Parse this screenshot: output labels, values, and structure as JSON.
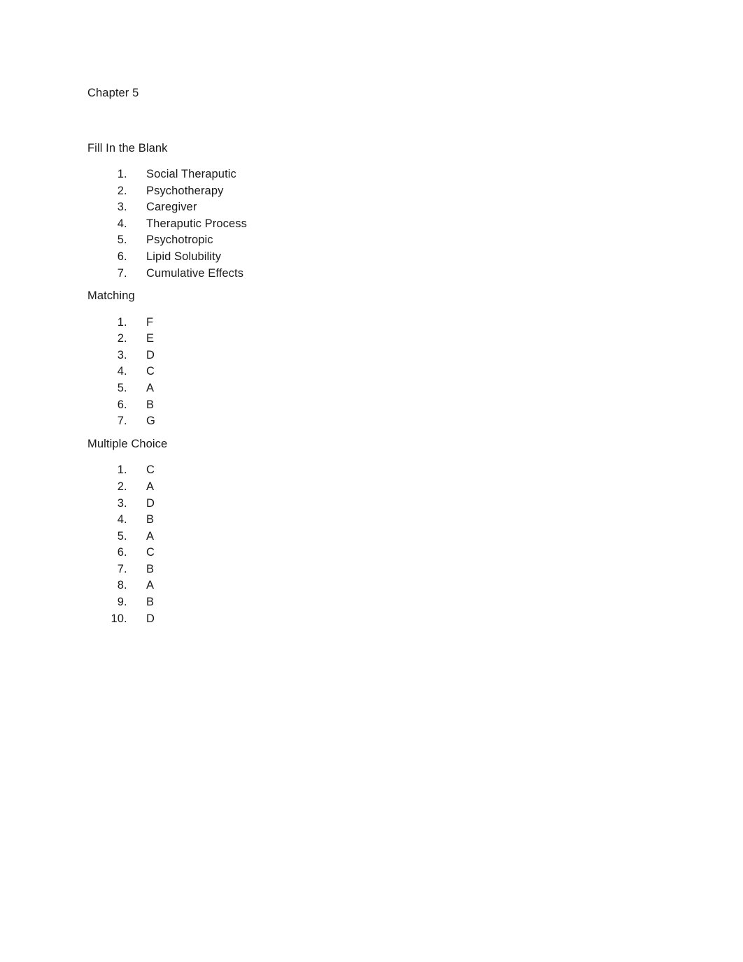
{
  "document": {
    "title": "Chapter 5",
    "sections": [
      {
        "heading": "Fill In the Blank",
        "items": [
          "Social Theraputic",
          "Psychotherapy",
          "Caregiver",
          "Theraputic Process",
          "Psychotropic",
          "Lipid Solubility",
          "Cumulative Effects"
        ]
      },
      {
        "heading": "Matching",
        "items": [
          "F",
          "E",
          "D",
          "C",
          "A",
          "B",
          "G"
        ]
      },
      {
        "heading": "Multiple Choice",
        "items": [
          "C",
          "A",
          "D",
          "B",
          "A",
          "C",
          "B",
          "A",
          "B",
          "D"
        ]
      }
    ]
  },
  "style": {
    "text_color": "#1a1a1a",
    "page_background": "#ffffff"
  }
}
